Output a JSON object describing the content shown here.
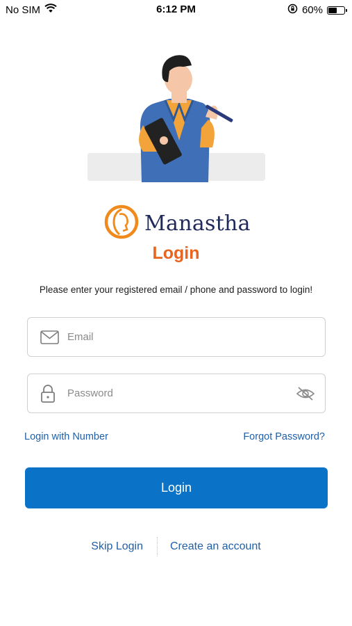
{
  "status_bar": {
    "carrier": "No SIM",
    "time": "6:12 PM",
    "battery_percent_text": "60%",
    "battery_level": 0.6,
    "icons": [
      "wifi-icon",
      "rotation-lock-icon",
      "battery-icon"
    ]
  },
  "brand": {
    "name": "Manastha",
    "logo_icon": "manastha-logo-icon"
  },
  "page": {
    "title": "Login",
    "instructions": "Please enter your registered email / phone and password to login!"
  },
  "form": {
    "email_placeholder": "Email",
    "email_value": "",
    "email_icon": "mail-icon",
    "password_placeholder": "Password",
    "password_value": "",
    "password_icon": "lock-icon",
    "visibility_icon": "eye-off-icon"
  },
  "links": {
    "login_with_number": "Login with Number",
    "forgot_password": "Forgot Password?",
    "skip_login": "Skip Login",
    "create_account": "Create an account"
  },
  "buttons": {
    "login": "Login"
  },
  "colors": {
    "primary_button": "#0a73c8",
    "title_accent": "#e8641f",
    "link": "#1f5fa8",
    "brand_text": "#1f2a5a"
  }
}
